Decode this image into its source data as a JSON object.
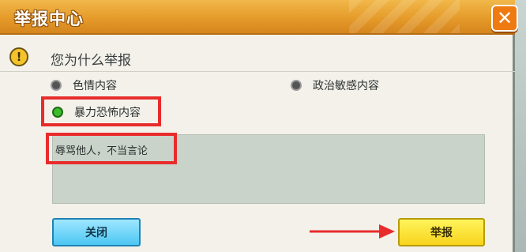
{
  "dialog": {
    "title": "举报中心",
    "close_icon": "close-x-icon"
  },
  "question": {
    "icon": "warning-icon",
    "icon_glyph": "!",
    "text": "您为什么举报"
  },
  "options": [
    {
      "label": "色情内容",
      "selected": false
    },
    {
      "label": "政治敏感内容",
      "selected": false
    },
    {
      "label": "暴力恐怖内容",
      "selected": true
    }
  ],
  "textbox": {
    "value": "辱骂他人，不当言论"
  },
  "buttons": {
    "close_label": "关闭",
    "report_label": "举报"
  },
  "colors": {
    "title_bar": "#e59b2a",
    "highlight": "#e82c2c",
    "selected_radio": "#3cbc2c",
    "close_button": "#4cc6f3",
    "report_button": "#f8d41c"
  }
}
